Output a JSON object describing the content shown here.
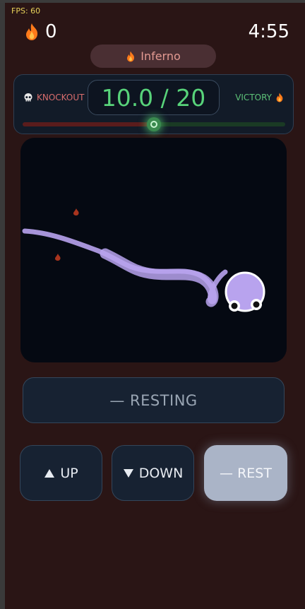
{
  "hud": {
    "fps": "FPS: 60",
    "score": "0",
    "timer": "4:55",
    "flame_color": "#ff7a1a"
  },
  "mode": {
    "label": "Inferno"
  },
  "meter": {
    "left_label": "KNOCKOUT",
    "right_label": "VICTORY",
    "score_text": "10.0 / 20",
    "value": 10.0,
    "max": 20,
    "accent_green": "#58d37a",
    "accent_red": "#d86d6d"
  },
  "status": {
    "text": "— RESTING"
  },
  "controls": {
    "up_label": "UP",
    "down_label": "DOWN",
    "rest_label": "— REST",
    "active": "rest"
  },
  "player": {
    "color": "#b8a3ee"
  }
}
